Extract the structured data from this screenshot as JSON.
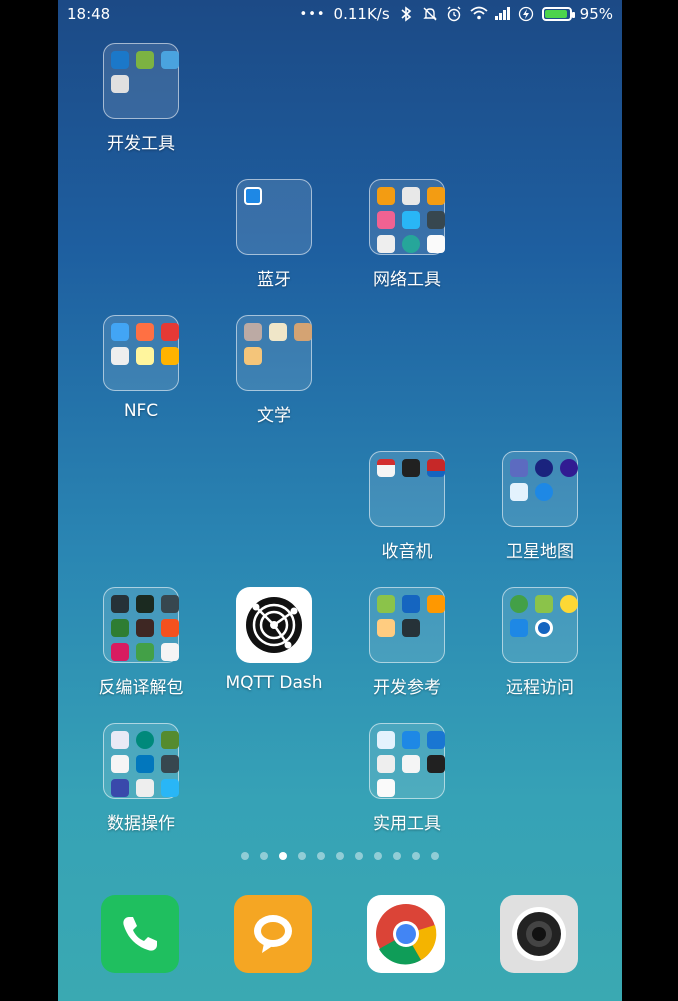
{
  "status_bar": {
    "time": "18:48",
    "more": "•••",
    "speed": "0.11K/s",
    "battery": "95%",
    "battery_level": 0.95,
    "icons": [
      "bluetooth-icon",
      "mute-icon",
      "alarm-icon",
      "wifi-icon",
      "signal-icon",
      "charging-icon",
      "battery-icon"
    ]
  },
  "folders": {
    "dev_tools": {
      "label": "开发工具"
    },
    "bluetooth": {
      "label": "蓝牙"
    },
    "net_tools": {
      "label": "网络工具"
    },
    "nfc": {
      "label": "NFC"
    },
    "literature": {
      "label": "文学"
    },
    "radio": {
      "label": "收音机"
    },
    "satellite_map": {
      "label": "卫星地图"
    },
    "decompile": {
      "label": "反编译解包"
    },
    "dev_reference": {
      "label": "开发参考"
    },
    "remote_access": {
      "label": "远程访问"
    },
    "data_ops": {
      "label": "数据操作"
    },
    "utilities": {
      "label": "实用工具"
    }
  },
  "apps": {
    "mqtt_dash": {
      "label": "MQTT Dash"
    }
  },
  "page_indicator": {
    "count": 11,
    "active_index": 2
  },
  "dock": [
    "phone-icon",
    "messaging-icon",
    "chrome-icon",
    "camera-icon"
  ],
  "colors": {
    "bg_top": "#1c4a86",
    "bg_bottom": "#3aa9b2",
    "phone": "#1fbf5f",
    "messaging": "#f5a623",
    "battery": "#4cd34c"
  }
}
